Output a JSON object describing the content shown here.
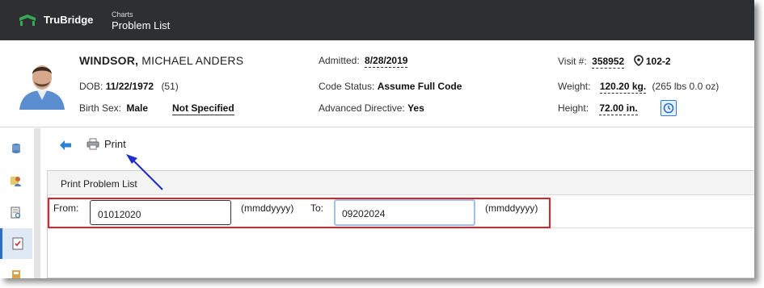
{
  "app": {
    "brand": "TruBridge",
    "section": "Charts",
    "page_title": "Problem List"
  },
  "patient": {
    "last_name": "WINDSOR,",
    "first_names": "MICHAEL ANDERS",
    "dob_label": "DOB:",
    "dob": "11/22/1972",
    "age": "(51)",
    "birth_sex_label": "Birth Sex:",
    "birth_sex": "Male",
    "gender_identity": "Not Specified",
    "admitted_label": "Admitted:",
    "admitted": "8/28/2019",
    "code_status_label": "Code Status:",
    "code_status": "Assume Full Code",
    "adv_directive_label": "Advanced Directive:",
    "adv_directive": "Yes",
    "visit_label": "Visit #:",
    "visit": "358952",
    "room": "102-2",
    "weight_label": "Weight:",
    "weight": "120.20 kg.",
    "weight_lbs": "(265 lbs 0.0 oz)",
    "height_label": "Height:",
    "height": "72.00 in."
  },
  "toolbar": {
    "print_label": "Print"
  },
  "panel": {
    "title": "Print Problem List",
    "from_label": "From:",
    "from_value": "01012020",
    "from_format": "(mmddyyyy)",
    "to_label": "To:",
    "to_value": "09202024",
    "to_format": "(mmddyyyy)"
  },
  "colors": {
    "topbar": "#2d2f33",
    "accent": "#2a6fc9",
    "highlight": "#d9232d",
    "annotation_arrow": "#1f2fcc"
  },
  "icons": {
    "rail": [
      "database-icon",
      "person-map-icon",
      "document-search-icon",
      "checklist-icon",
      "book-icon"
    ],
    "toolbar": [
      "back-arrow-icon",
      "printer-icon"
    ]
  }
}
